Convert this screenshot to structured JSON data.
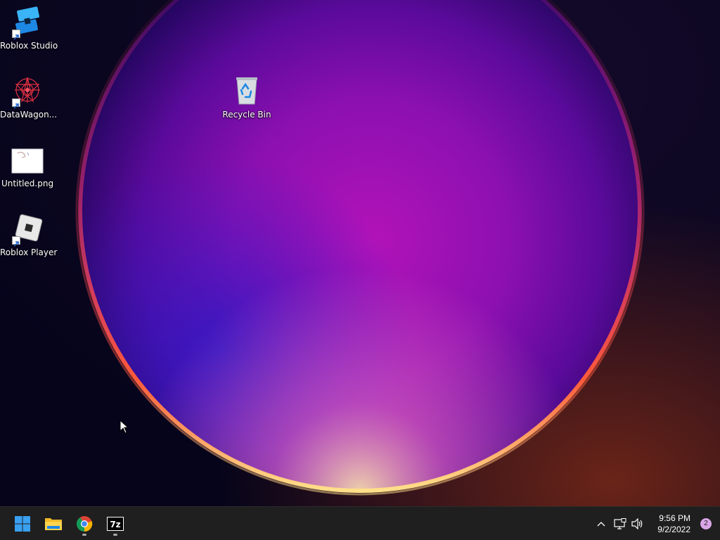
{
  "desktop": {
    "icons": [
      {
        "label": "Roblox Studio",
        "icon": "roblox-studio-icon",
        "shortcut": true
      },
      {
        "label": "DataWagon...",
        "icon": "datawagon-icon",
        "shortcut": true
      },
      {
        "label": "Untitled.png",
        "icon": "image-file-icon",
        "shortcut": false
      },
      {
        "label": "Roblox Player",
        "icon": "roblox-player-icon",
        "shortcut": true
      },
      {
        "label": "Recycle Bin",
        "icon": "recycle-bin-icon",
        "shortcut": false
      }
    ]
  },
  "taskbar": {
    "apps": [
      {
        "name": "Start",
        "icon": "windows-start-icon",
        "running": false
      },
      {
        "name": "File Explorer",
        "icon": "file-explorer-icon",
        "running": false
      },
      {
        "name": "Google Chrome",
        "icon": "chrome-icon",
        "running": true
      },
      {
        "name": "7-Zip",
        "icon": "seven-zip-icon",
        "running": true
      }
    ],
    "tray": {
      "icons": [
        "chevron-up-icon",
        "network-icon",
        "volume-icon"
      ],
      "time": "9:56 PM",
      "date": "9/2/2022",
      "notification_count": "2"
    }
  },
  "colors": {
    "taskbar_bg": "#1f1f1f",
    "windows_blue": "#3aa0f0",
    "badge": "#d9a5e6"
  }
}
